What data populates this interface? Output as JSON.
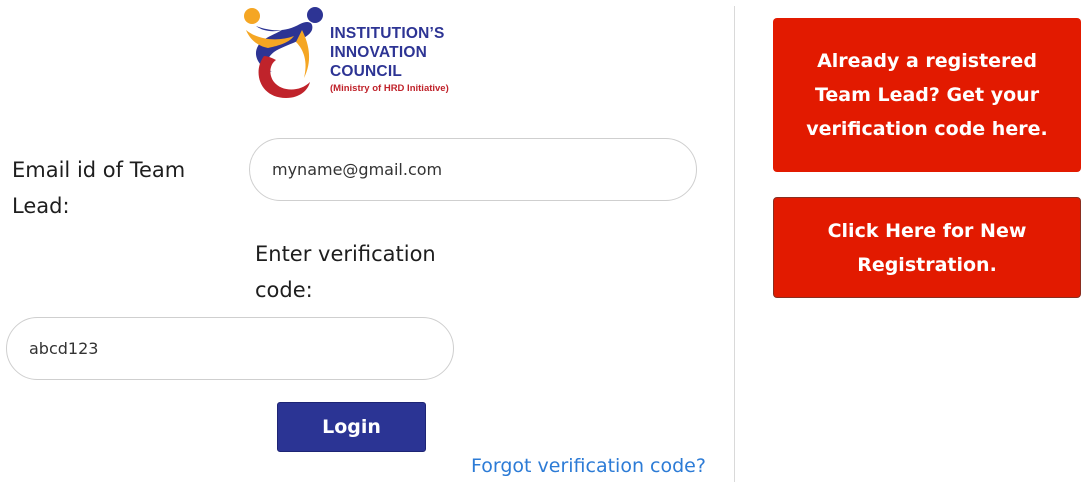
{
  "logo": {
    "title": "INSTITUTION’S\nINNOVATION\nCOUNCIL",
    "subtitle": "(Ministry of HRD Initiative)",
    "colors": {
      "navy": "#2d3494",
      "red": "#c0232b",
      "orange": "#f5a623"
    }
  },
  "form": {
    "email_label": "Email id of Team Lead:",
    "email_placeholder": "myname@gmail.com",
    "code_label": "Enter verification code:",
    "code_placeholder": "abcd123",
    "login_label": "Login",
    "forgot_label": "Forgot verification code?"
  },
  "side": {
    "registered_label": "Already a registered Team Lead? Get your verification code here.",
    "new_registration_label": "Click Here for New Registration."
  },
  "colors": {
    "primary": "#2b3494",
    "danger": "#e21a00",
    "link": "#2c7bd6"
  }
}
